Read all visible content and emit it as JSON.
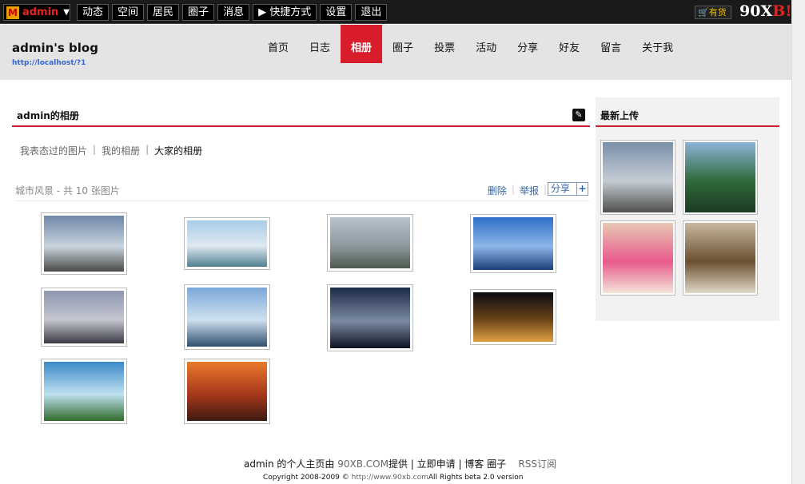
{
  "topbar": {
    "username": "admin",
    "nav": [
      "动态",
      "空间",
      "居民",
      "圈子",
      "消息",
      "▶ 快捷方式",
      "设置",
      "退出"
    ],
    "cart_label": "有货",
    "brand_prefix": "90X",
    "brand_b": "B",
    "brand_suffix": "!"
  },
  "header": {
    "blog_title": "admin's blog",
    "blog_url": "http://localhost/?1",
    "nav": [
      "首页",
      "日志",
      "相册",
      "圈子",
      "投票",
      "活动",
      "分享",
      "好友",
      "留言",
      "关于我"
    ],
    "active_nav": "相册"
  },
  "main": {
    "section_title": "admin的相册",
    "subtabs": [
      "我表态过的图片",
      "我的相册",
      "大家的相册"
    ],
    "current_subtab": "大家的相册",
    "album_name": "城市风景",
    "album_count_text": " - 共  10 张图片",
    "actions": [
      "删除",
      "举报"
    ],
    "share_label": "分享",
    "photos": [
      {
        "name": "photo-city-skyline-1",
        "colors": [
          "#6f87a8",
          "#c9d4de",
          "#4a4a46"
        ]
      },
      {
        "name": "photo-harbor-city",
        "colors": [
          "#a8cde8",
          "#dfe9f0",
          "#4f8090"
        ]
      },
      {
        "name": "photo-highway-city",
        "colors": [
          "#b6c3cd",
          "#8e9aa0",
          "#4d5a4e"
        ]
      },
      {
        "name": "photo-glass-towers",
        "colors": [
          "#2f6fc8",
          "#8cb6e8",
          "#1d3f7a"
        ]
      },
      {
        "name": "photo-downtown-dusk",
        "colors": [
          "#8e97b0",
          "#c5c6cf",
          "#3a3b44"
        ]
      },
      {
        "name": "photo-lake-skyline",
        "colors": [
          "#7aa8d8",
          "#cfe0ef",
          "#2f4f6e"
        ]
      },
      {
        "name": "photo-skyscraper-up",
        "colors": [
          "#1c2a4a",
          "#7b8aa2",
          "#0d1424"
        ]
      },
      {
        "name": "photo-night-city",
        "colors": [
          "#0b0b12",
          "#6a4418",
          "#e0a040"
        ]
      },
      {
        "name": "photo-waterfront-trees",
        "colors": [
          "#3a8ac8",
          "#bfe0f0",
          "#2f6a2a"
        ]
      },
      {
        "name": "photo-sunset-city",
        "colors": [
          "#e8792a",
          "#a8381c",
          "#3d1a10"
        ]
      }
    ]
  },
  "sidebar": {
    "title": "最新上传",
    "photos": [
      {
        "name": "recent-city-skyline",
        "colors": [
          "#7a8fa8",
          "#c4ccd4",
          "#50504c"
        ]
      },
      {
        "name": "recent-mountain-lake",
        "colors": [
          "#8bb4d8",
          "#2f6a3a",
          "#1d3a22"
        ]
      },
      {
        "name": "recent-portrait",
        "colors": [
          "#e8c8b4",
          "#e85a8c",
          "#f4e4d8"
        ]
      },
      {
        "name": "recent-marmot",
        "colors": [
          "#c8b8a0",
          "#6a5030",
          "#e0d8c8"
        ]
      }
    ]
  },
  "footer": {
    "line1_owner": "admin 的个人主页由 ",
    "line1_site": "90XB.COM",
    "line1_provided": "提供 | 立即申请 | 博客  圈子",
    "line1_rss": "RSS订阅",
    "line2_copyright": "Copyright 2008-2009 © ",
    "line2_url": "http://www.90xb.com",
    "line2_rights": "All Rights beta 2.0 version"
  }
}
